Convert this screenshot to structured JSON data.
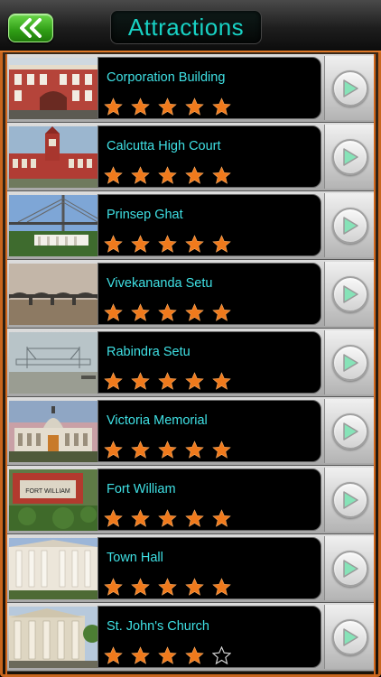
{
  "header": {
    "title": "Attractions",
    "back_icon": "double-chevron-left-icon"
  },
  "colors": {
    "accent_orange": "#f07a1c",
    "title_cyan": "#18d2c4",
    "name_cyan": "#3fe0e4",
    "back_green": "#2f9d15",
    "play_green": "#7fe0b0"
  },
  "attractions": [
    {
      "name": "Corporation Building",
      "rating": 5,
      "max_rating": 5
    },
    {
      "name": "Calcutta High Court",
      "rating": 5,
      "max_rating": 5
    },
    {
      "name": "Prinsep Ghat",
      "rating": 5,
      "max_rating": 5
    },
    {
      "name": "Vivekananda Setu",
      "rating": 5,
      "max_rating": 5
    },
    {
      "name": "Rabindra Setu",
      "rating": 5,
      "max_rating": 5
    },
    {
      "name": "Victoria Memorial",
      "rating": 5,
      "max_rating": 5
    },
    {
      "name": "Fort William",
      "rating": 5,
      "max_rating": 5,
      "photo_sign_text": "FORT WILLIAM"
    },
    {
      "name": "Town Hall",
      "rating": 5,
      "max_rating": 5
    },
    {
      "name": "St. John's Church",
      "rating": 4,
      "max_rating": 5
    }
  ]
}
